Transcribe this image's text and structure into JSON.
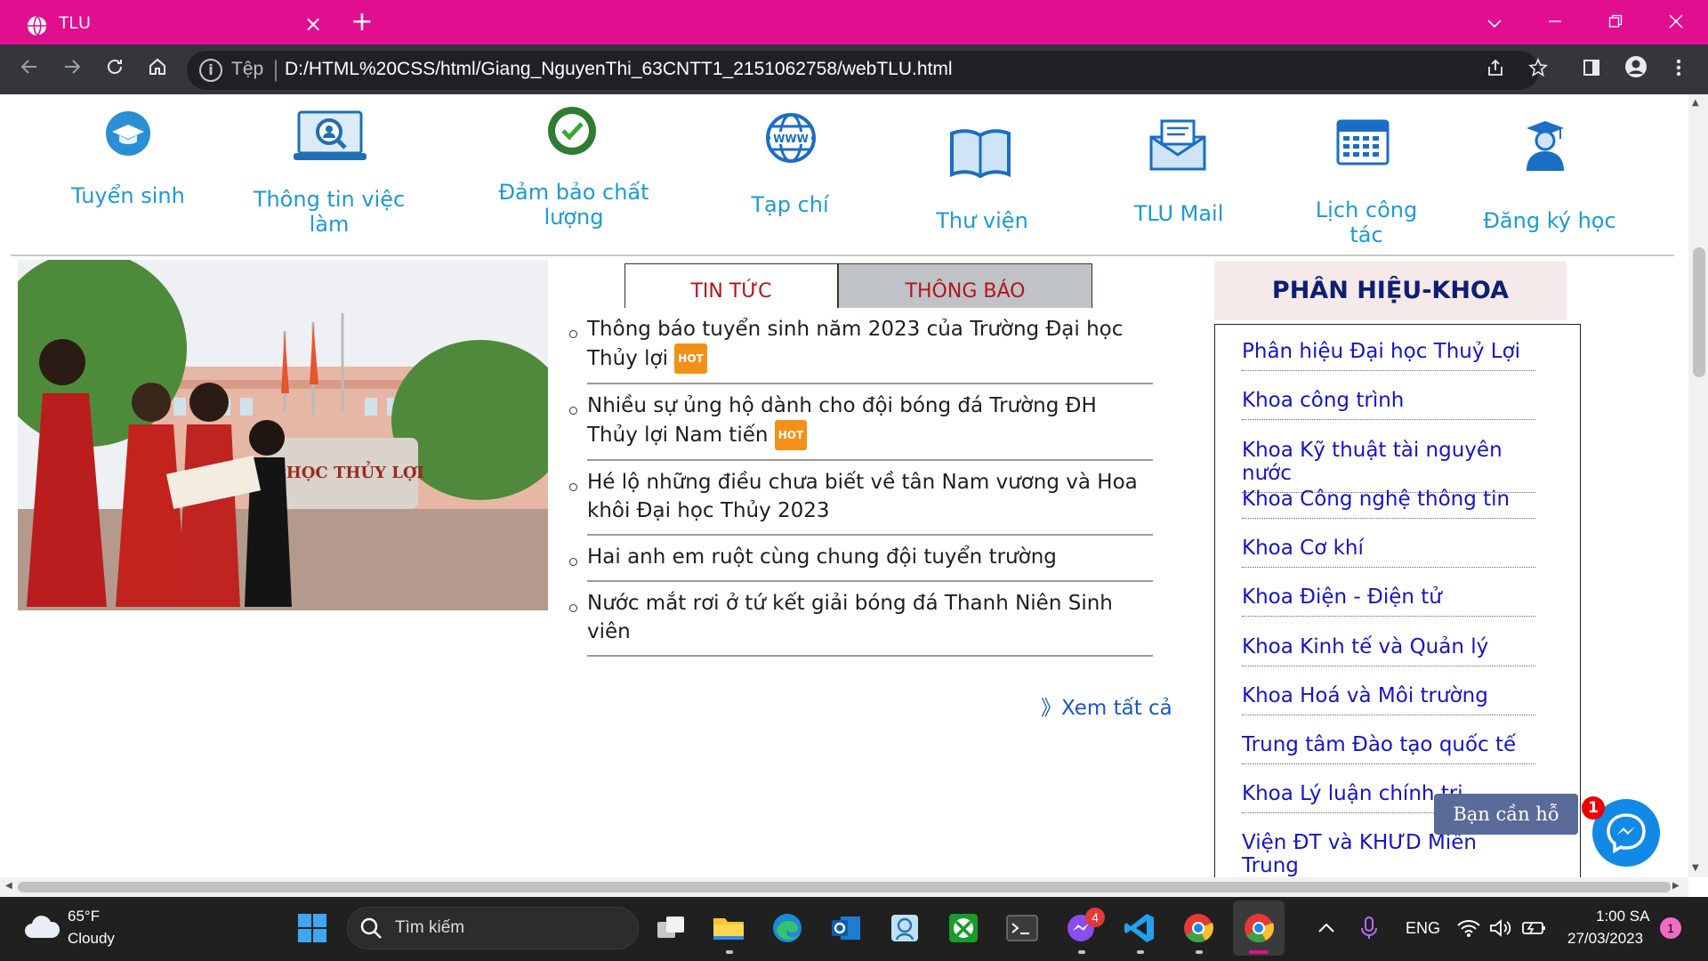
{
  "browser": {
    "tab_title": "TLU",
    "new_tab": "+",
    "close_tab": "×",
    "omnibox_scheme": "Tệp",
    "omnibox_sep": "|",
    "url": "D:/HTML%20CSS/html/Giang_NguyenThi_63CNTT1_2151062758/webTLU.html"
  },
  "quick_links": [
    {
      "label": "Tuyển sinh",
      "icon": "graduation-cap-icon"
    },
    {
      "label": "Thông tin việc làm",
      "icon": "job-search-icon"
    },
    {
      "label": "Đảm bảo chất lượng",
      "icon": "quality-assurance-icon"
    },
    {
      "label": "Tạp chí",
      "icon": "www-globe-icon"
    },
    {
      "label": "Thư viện",
      "icon": "open-book-icon"
    },
    {
      "label": "TLU Mail",
      "icon": "mail-icon"
    },
    {
      "label": "Lịch công tác",
      "icon": "calendar-icon"
    },
    {
      "label": "Đăng ký học",
      "icon": "graduate-student-icon"
    }
  ],
  "news_tabs": [
    "TIN TỨC",
    "THÔNG BÁO"
  ],
  "news": [
    {
      "title": "Thông báo tuyển sinh năm 2023 của Trường Đại học Thủy lợi",
      "hot": true
    },
    {
      "title": "Nhiều sự ủng hộ dành cho đội bóng đá Trường ĐH Thủy lợi Nam tiến",
      "hot": true
    },
    {
      "title": "Hé lộ những điều chưa biết về tân Nam vương và Hoa khôi Đại học Thủy 2023",
      "hot": false
    },
    {
      "title": "Hai anh em ruột cùng chung đội tuyển trường",
      "hot": false
    },
    {
      "title": "Nước mắt rơi ở tứ kết giải bóng đá Thanh Niên Sinh viên",
      "hot": false
    }
  ],
  "hot_label": "HOT",
  "view_all": "》Xem tất cả",
  "sidebar": {
    "title": "PHÂN HIỆU-KHOA",
    "items": [
      "Phân hiệu Đại học Thuỷ Lợi",
      "Khoa công trình",
      "Khoa Kỹ thuật tài nguyên nước",
      "Khoa Công nghệ thông tin",
      "Khoa Cơ khí",
      "Khoa Điện - Điện tử",
      "Khoa Kinh tế và Quản lý",
      "Khoa Hoá và Môi trường",
      "Trung tâm Đào tạo quốc tế",
      "Khoa Lý luận chính trị",
      "Viện ĐT và KHƯD Miền Trung"
    ]
  },
  "chat": {
    "label": "Bạn cần hỗ trợ?",
    "badge": "1"
  },
  "taskbar": {
    "weather_temp": "65°F",
    "weather_desc": "Cloudy",
    "search_placeholder": "Tìm kiếm",
    "messenger_badge": "4",
    "lang": "ENG",
    "time": "1:00 SA",
    "date": "27/03/2023",
    "notif_count": "1"
  },
  "colors": {
    "titlebar": "#e10f8f",
    "link_blue": "#1c9ad6",
    "sidebar_link": "#1414c8",
    "tab_text": "#b5141b"
  }
}
